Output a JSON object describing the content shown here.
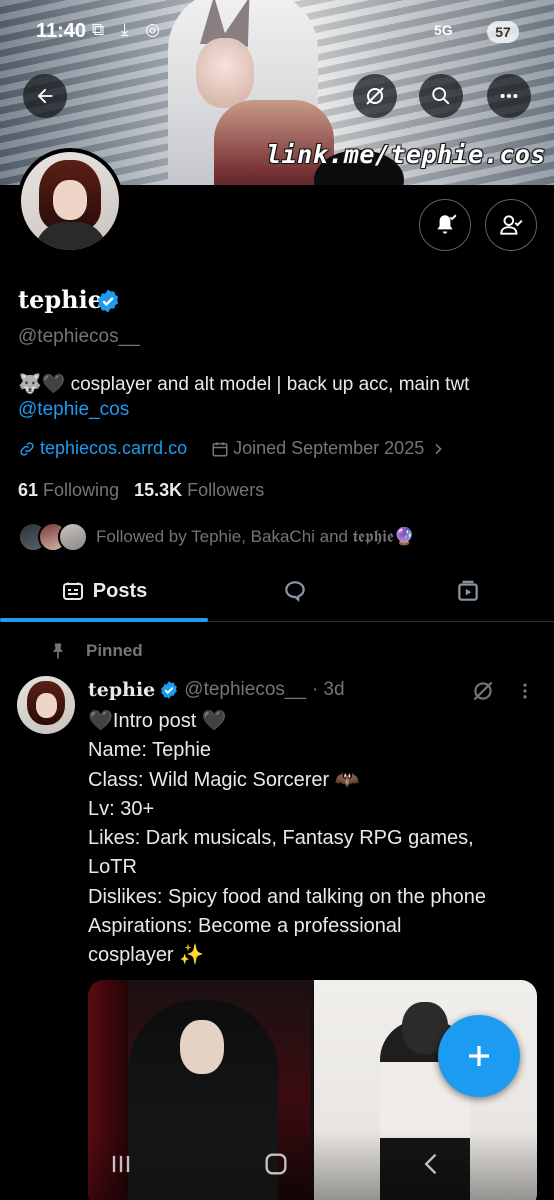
{
  "status_bar": {
    "time": "11:40",
    "left_icons": "⧉ ⤓ ◎",
    "network": "5G",
    "battery": "57"
  },
  "banner": {
    "link_text": "link.me/tephie.cos"
  },
  "profile": {
    "name": "tephie",
    "handle": "@tephiecos__",
    "bio_text": "🐺🖤 cosplayer and alt model | back up acc, main twt",
    "bio_link": "@tephie_cos",
    "website": "tephiecos.carrd.co",
    "joined": "Joined September 2025",
    "following_count": "61",
    "following_label": "Following",
    "followers_count": "15.3K",
    "followers_label": "Followers",
    "followed_by": "Followed by Tephie, BakaChi and 𝖙𝖊𝖕𝖍𝖎𝖊🔮"
  },
  "tabs": [
    {
      "label": "Posts",
      "icon": "posts-icon"
    },
    {
      "label": "",
      "icon": "replies-icon"
    },
    {
      "label": "",
      "icon": "media-icon"
    }
  ],
  "post": {
    "pinned_label": "Pinned",
    "author_name": "tephie",
    "author_handle": "@tephiecos__",
    "separator": "·",
    "time": "3d",
    "text": "🖤Intro post 🖤\nName: Tephie\nClass: Wild Magic Sorcerer 🦇\nLv: 30+\nLikes: Dark musicals, Fantasy RPG games,\nLoTR\nDislikes: Spicy food and talking on the phone\nAspirations: Become a professional\ncosplayer ✨"
  },
  "colors": {
    "accent": "#1d9bf0",
    "secondary_text": "#71767b",
    "primary_text": "#e7e9ea",
    "background": "#000000"
  }
}
